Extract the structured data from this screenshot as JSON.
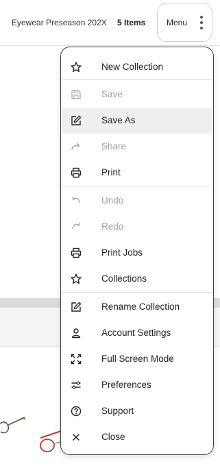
{
  "header": {
    "collection_title": "Eyewear Preseason 202X",
    "items_count": "5 Items",
    "menu_label": "Menu"
  },
  "menu": {
    "items": [
      {
        "label": "New Collection",
        "icon": "star-icon",
        "enabled": true
      },
      {
        "label": "Save",
        "icon": "save-icon",
        "enabled": false
      },
      {
        "label": "Save As",
        "icon": "edit-icon",
        "enabled": true,
        "highlighted": true
      },
      {
        "label": "Share",
        "icon": "share-arrow-icon",
        "enabled": false
      },
      {
        "label": "Print",
        "icon": "printer-icon",
        "enabled": true
      },
      {
        "label": "Undo",
        "icon": "undo-icon",
        "enabled": false
      },
      {
        "label": "Redo",
        "icon": "redo-icon",
        "enabled": false
      },
      {
        "label": "Print Jobs",
        "icon": "printer-icon",
        "enabled": true
      },
      {
        "label": "Collections",
        "icon": "star-icon",
        "enabled": true
      },
      {
        "label": "Rename Collection",
        "icon": "edit-icon",
        "enabled": true
      },
      {
        "label": "Account Settings",
        "icon": "user-icon",
        "enabled": true
      },
      {
        "label": "Full Screen Mode",
        "icon": "fullscreen-icon",
        "enabled": true
      },
      {
        "label": "Preferences",
        "icon": "sliders-icon",
        "enabled": true
      },
      {
        "label": "Support",
        "icon": "help-circle-icon",
        "enabled": true
      },
      {
        "label": "Close",
        "icon": "close-icon",
        "enabled": true
      }
    ]
  },
  "colors": {
    "text": "#222222",
    "disabled_text": "#a0a0a0",
    "highlight_bg": "#efefef",
    "frame_red": "#c0392b"
  }
}
